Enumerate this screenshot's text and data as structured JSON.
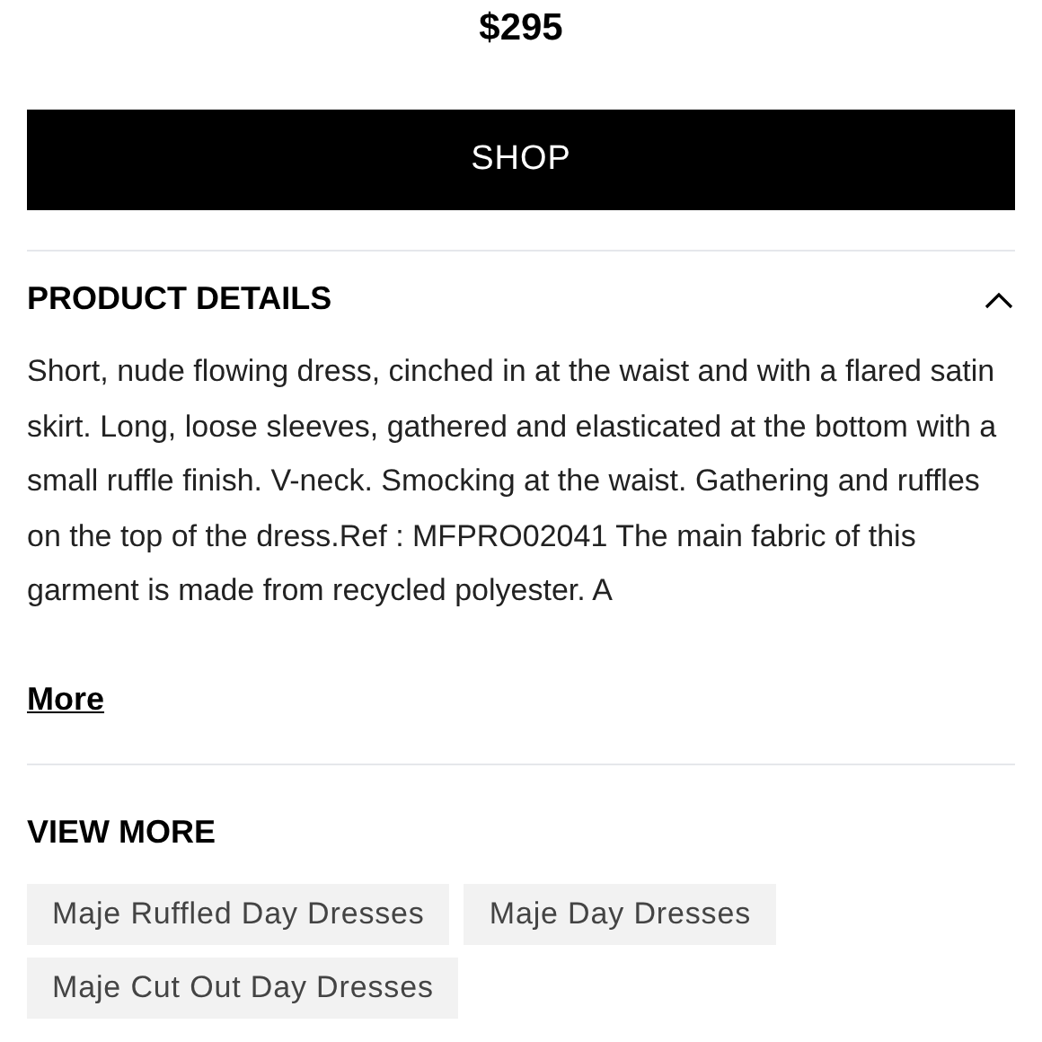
{
  "price": "$295",
  "shop_button": "SHOP",
  "product_details": {
    "title": "PRODUCT DETAILS",
    "expanded": true,
    "text": "Short, nude flowing dress, cinched in at the waist and with a flared satin skirt. Long, loose sleeves, gathered and elasticated at the bottom with a small ruffle finish. V-neck. Smocking at the waist. Gathering and ruffles on the top of the dress.Ref : MFPRO02041 The main fabric of this garment is made from recycled polyester. A",
    "more_link": "More"
  },
  "view_more": {
    "title": "VIEW MORE",
    "tags": [
      "Maje Ruffled Day Dresses",
      "Maje Day Dresses",
      "Maje Cut Out Day Dresses"
    ]
  }
}
